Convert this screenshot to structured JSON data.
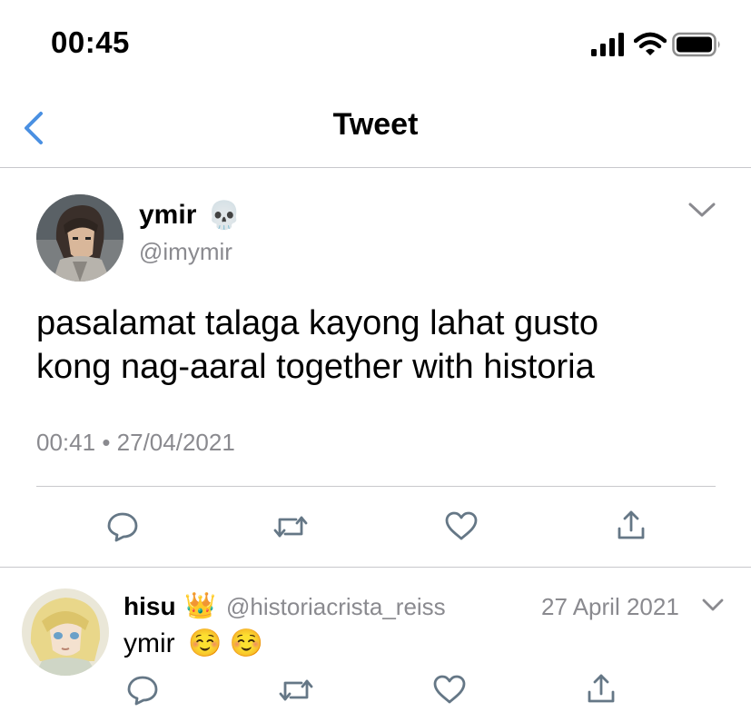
{
  "status_bar": {
    "time": "00:45",
    "icons": [
      "cellular-signal-icon",
      "wifi-icon",
      "battery-icon"
    ]
  },
  "nav": {
    "title": "Tweet",
    "back_icon": "chevron-left-icon"
  },
  "tweet": {
    "display_name": "ymir",
    "name_emoji": "💀",
    "handle": "@imymir",
    "text_line1": "pasalamat talaga kayong lahat gusto",
    "text_line2": "kong nag-aaral together with historia",
    "time": "00:41",
    "separator": "•",
    "date": "27/04/2021",
    "menu_icon": "chevron-down-icon",
    "actions": [
      "reply-icon",
      "retweet-icon",
      "like-icon",
      "share-icon"
    ]
  },
  "reply": {
    "display_name": "hisu",
    "name_emoji": "👑",
    "handle": "@historiacrista_reiss",
    "date": "27 April 2021",
    "text": "ymir",
    "text_emojis": "☺️ ☺️",
    "menu_icon": "chevron-down-icon",
    "actions": [
      "reply-icon",
      "retweet-icon",
      "like-icon",
      "share-icon"
    ]
  },
  "colors": {
    "accent": "#4a90e2",
    "secondary_text": "#8a8a8f",
    "divider": "#c8c8cc",
    "icon": "#657786"
  }
}
